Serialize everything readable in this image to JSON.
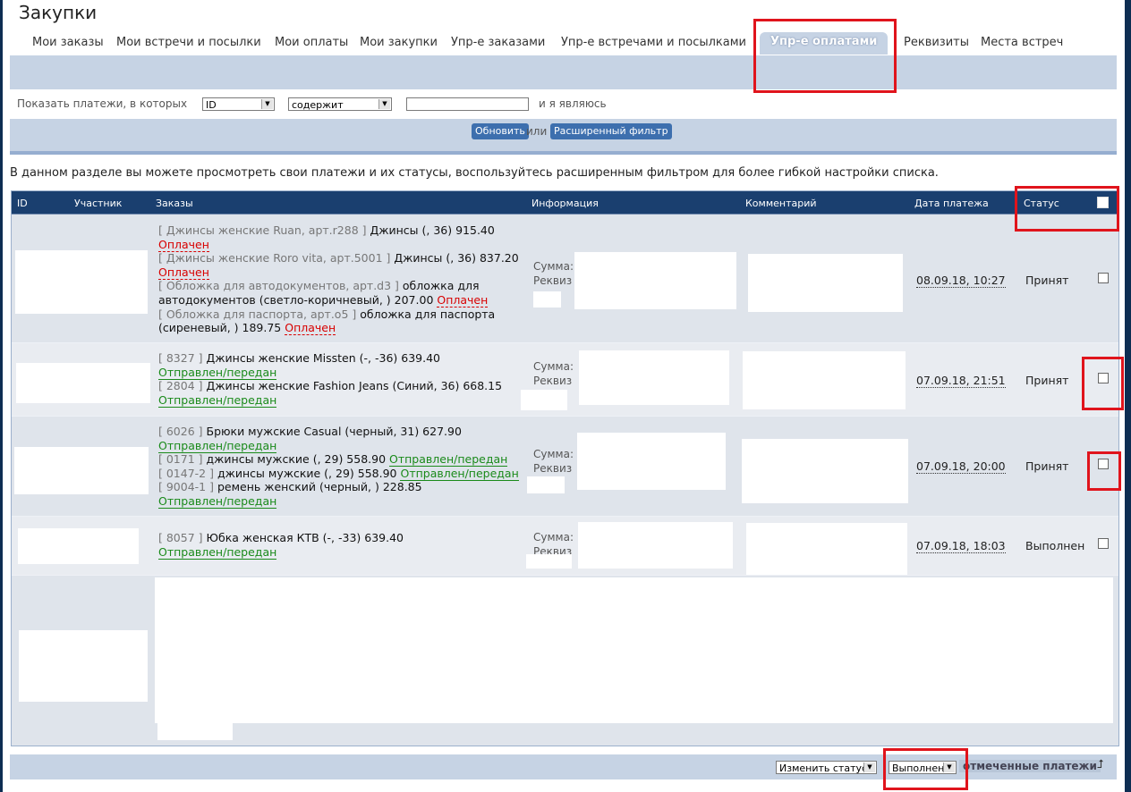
{
  "title": "Закупки",
  "tabs": [
    {
      "label": "Мои заказы"
    },
    {
      "label": "Мои встречи и посылки"
    },
    {
      "label": "Мои оплаты"
    },
    {
      "label": "Мои закупки"
    },
    {
      "label": "Упр-е заказами"
    },
    {
      "label": "Упр-е встречами и посылками"
    },
    {
      "label": "Упр-е оплатами",
      "active": true
    },
    {
      "label": "Реквизиты"
    },
    {
      "label": "Места встреч"
    }
  ],
  "filter": {
    "prefix": "Показать платежи, в которых",
    "field_value": "ID",
    "condition_value": "содержит",
    "suffix": "и я являюсь"
  },
  "buttons": {
    "refresh": "Обновить",
    "or": "или",
    "advanced": "Расширенный фильтр"
  },
  "info_text": "В данном разделе вы можете просмотреть свои платежи и их статусы, воспользуйтесь расширенным фильтром для более гибкой настройки списка.",
  "columns": {
    "id": "ID",
    "member": "Участник",
    "orders": "Заказы",
    "info": "Информация",
    "comment": "Комментарий",
    "date": "Дата платежа",
    "status": "Статус"
  },
  "rows": [
    {
      "orders": [
        {
          "bracket": "[ Джинсы женские Ruan, арт.r288 ]",
          "text": "Джинсы (, 36) 915.40",
          "state": "Оплачен",
          "state_kind": "paid"
        },
        {
          "bracket": "[ Джинсы женские Roro vita, арт.5001 ]",
          "text": "Джинсы (, 36) 837.20",
          "state": "Оплачен",
          "state_kind": "paid"
        },
        {
          "bracket": "[ Обложка для автодокументов, арт.d3 ]",
          "text": "обложка для автодокументов (светло-коричневый, ) 207.00",
          "state": "Оплачен",
          "state_kind": "paid"
        },
        {
          "bracket": "[ Обложка для паспорта, арт.o5 ]",
          "text": "обложка для паспорта (сиреневый, ) 189.75",
          "state": "Оплачен",
          "state_kind": "paid"
        }
      ],
      "info_sum": "Сумма:",
      "info_req": "Реквиз",
      "date": "08.09.18, 10:27",
      "status": "Принят"
    },
    {
      "orders": [
        {
          "bracket": "[ 8327 ]",
          "text": "Джинсы женские Missten (-, -36) 639.40",
          "state": "Отправлен/передан",
          "state_kind": "sent"
        },
        {
          "bracket": "[ 2804 ]",
          "text": "Джинсы женские Fashion Jeans (Синий, 36) 668.15",
          "state": "Отправлен/передан",
          "state_kind": "sent"
        }
      ],
      "info_sum": "Сумма:",
      "info_req": "Реквиз",
      "date": "07.09.18, 21:51",
      "status": "Принят"
    },
    {
      "orders": [
        {
          "bracket": "[ 6026 ]",
          "text": "Брюки мужские Casual (черный, 31) 627.90",
          "state": "Отправлен/передан",
          "state_kind": "sent"
        },
        {
          "bracket": "[ 0171 ]",
          "text": "джинсы мужские (, 29) 558.90",
          "state": "Отправлен/передан",
          "state_kind": "sent"
        },
        {
          "bracket": "[ 0147-2 ]",
          "text": "джинсы мужские (, 29) 558.90",
          "state": "Отправлен/передан",
          "state_kind": "sent"
        },
        {
          "bracket": "[ 9004-1 ]",
          "text": "ремень женский (черный, ) 228.85",
          "state": "Отправлен/передан",
          "state_kind": "sent"
        }
      ],
      "info_sum": "Сумма:",
      "info_req": "Реквиз",
      "date": "07.09.18, 20:00",
      "status": "Принят"
    },
    {
      "orders": [
        {
          "bracket": "[ 8057 ]",
          "text": "Юбка женская КТВ (-, -33) 639.40",
          "state": "Отправлен/передан",
          "state_kind": "sent"
        }
      ],
      "info_sum": "Сумма:",
      "info_req": "Реквиз",
      "date": "07.09.18, 18:03",
      "status": "Выполнен"
    }
  ],
  "footer": {
    "change_status": "Изменить статус",
    "status_value": "Выполнен",
    "apply": "отмеченные платежи"
  },
  "colors": {
    "header_bg": "#1a3f6f",
    "band": "#c6d3e4",
    "paid": "#d80000",
    "sent": "#1a8a1a",
    "highlight": "#e0141c"
  }
}
